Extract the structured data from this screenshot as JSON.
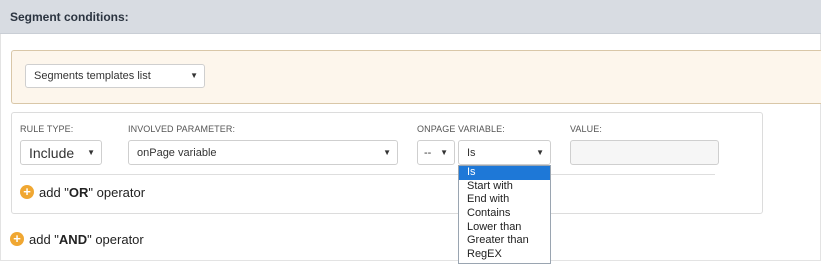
{
  "header": {
    "title": "Segment conditions:"
  },
  "templates": {
    "select_label": "Segments templates list"
  },
  "rule": {
    "rule_type_label": "RULE TYPE:",
    "rule_type_value": "Include",
    "involved_param_label": "INVOLVED PARAMETER:",
    "involved_param_value": "onPage variable",
    "onpage_var_label": "ONPAGE VARIABLE:",
    "onpage_var_value": "--",
    "operator_value": "Is",
    "value_label": "VALUE:",
    "value_input": ""
  },
  "or_operator": {
    "prefix": "add \"",
    "bold": "OR",
    "suffix": "\" operator"
  },
  "and_operator": {
    "prefix": "add \"",
    "bold": "AND",
    "suffix": "\" operator"
  },
  "operator_dropdown": {
    "options": [
      "Is",
      "Start with",
      "End with",
      "Contains",
      "Lower than",
      "Greater than",
      "RegEX"
    ],
    "selected_index": 0
  },
  "colors": {
    "accent_orange": "#f0a732",
    "selection_blue": "#1e78d7",
    "template_bg": "#fdf6ec"
  }
}
